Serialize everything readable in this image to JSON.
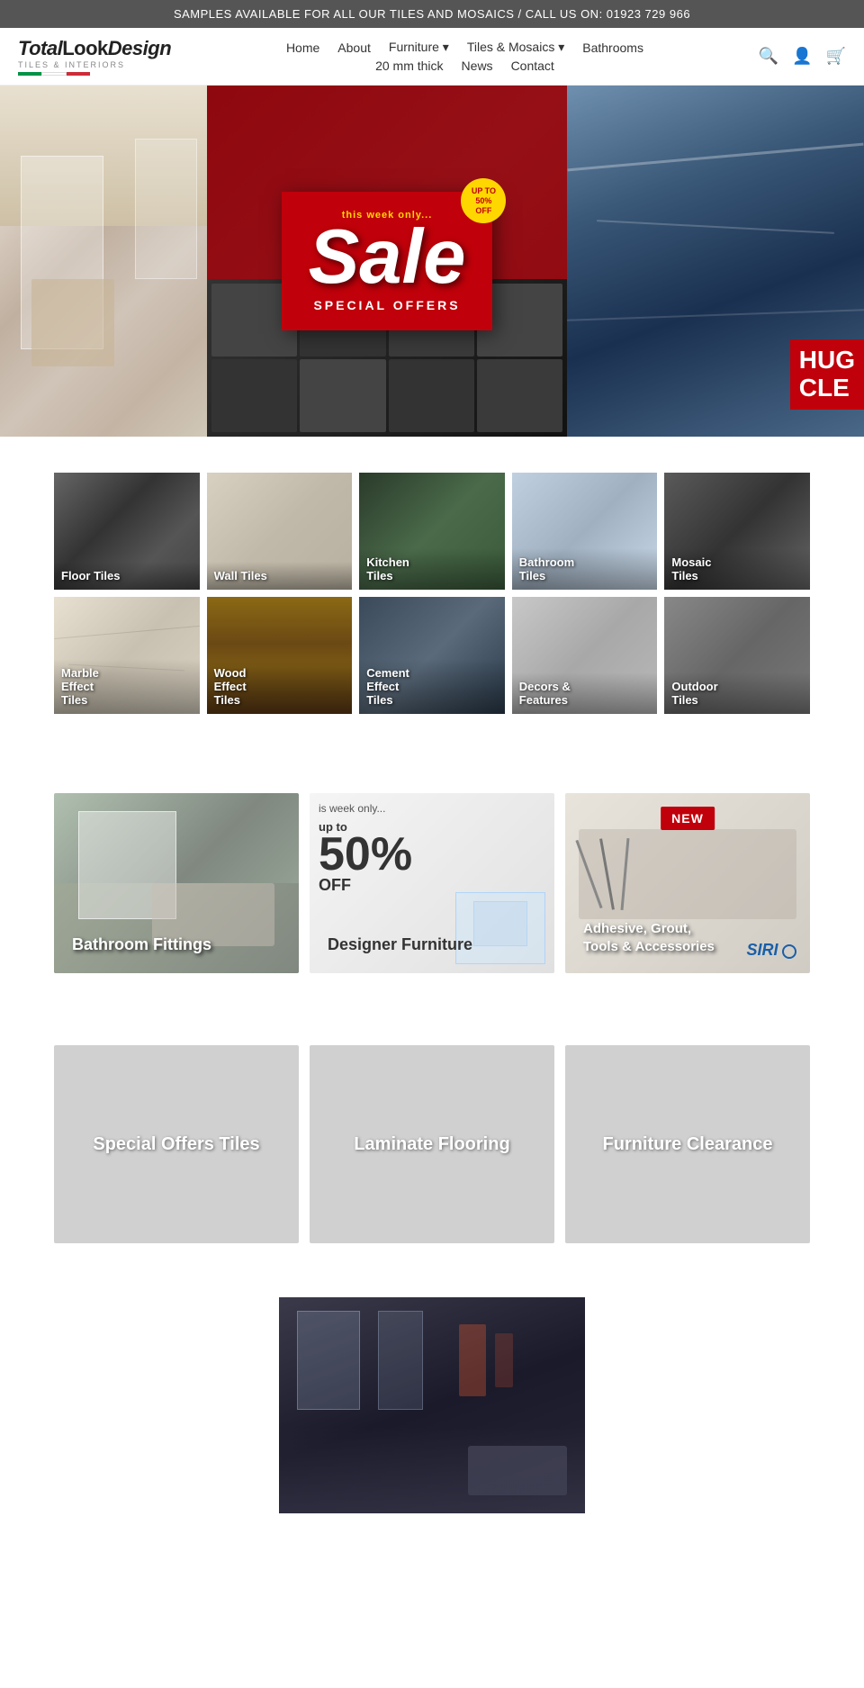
{
  "banner": {
    "text": "SAMPLES AVAILABLE FOR ALL OUR TILES AND MOSAICS / CALL US ON: 01923 729 966"
  },
  "logo": {
    "main": "TotalLookDesign",
    "sub": "TILES & INTERIORS"
  },
  "nav": {
    "row1": [
      "Home",
      "About",
      "Furniture ▾",
      "Tiles & Mosaics ▾",
      "Bathrooms"
    ],
    "row2": [
      "20 mm thick",
      "News",
      "Contact"
    ]
  },
  "hero": {
    "sale_text": "Sale",
    "special_offers": "SPECIAL OFFERS",
    "tag": "UP TO 50% OFF",
    "huge_clearance": "HUG\nCLE"
  },
  "tiles": {
    "row1": [
      {
        "label": "Floor Tiles",
        "class": "tile-floor"
      },
      {
        "label": "Wall Tiles",
        "class": "tile-wall"
      },
      {
        "label": "Kitchen Tiles",
        "class": "tile-kitchen"
      },
      {
        "label": "Bathroom Tiles",
        "class": "tile-bathroom"
      },
      {
        "label": "Mosaic Tiles",
        "class": "tile-mosaic"
      }
    ],
    "row2": [
      {
        "label": "Marble Effect Tiles",
        "class": "tile-marble"
      },
      {
        "label": "Wood Effect Tiles",
        "class": "tile-wood"
      },
      {
        "label": "Cement Effect Tiles",
        "class": "tile-cement"
      },
      {
        "label": "Decors & Features",
        "class": "tile-decors"
      },
      {
        "label": "Outdoor Tiles",
        "class": "tile-outdoor"
      }
    ]
  },
  "featured": [
    {
      "label": "Bathroom Fittings",
      "class": "feat-bathroom"
    },
    {
      "label": "Designer Furniture",
      "class": "feat-furniture",
      "sale": true
    },
    {
      "label": "Adhesive, Grout, Tools & Accessories",
      "class": "feat-tools",
      "new": true
    }
  ],
  "clearance": [
    {
      "label": "Special Offers Tiles"
    },
    {
      "label": "Laminate Flooring"
    },
    {
      "label": "Furniture Clearance"
    }
  ]
}
